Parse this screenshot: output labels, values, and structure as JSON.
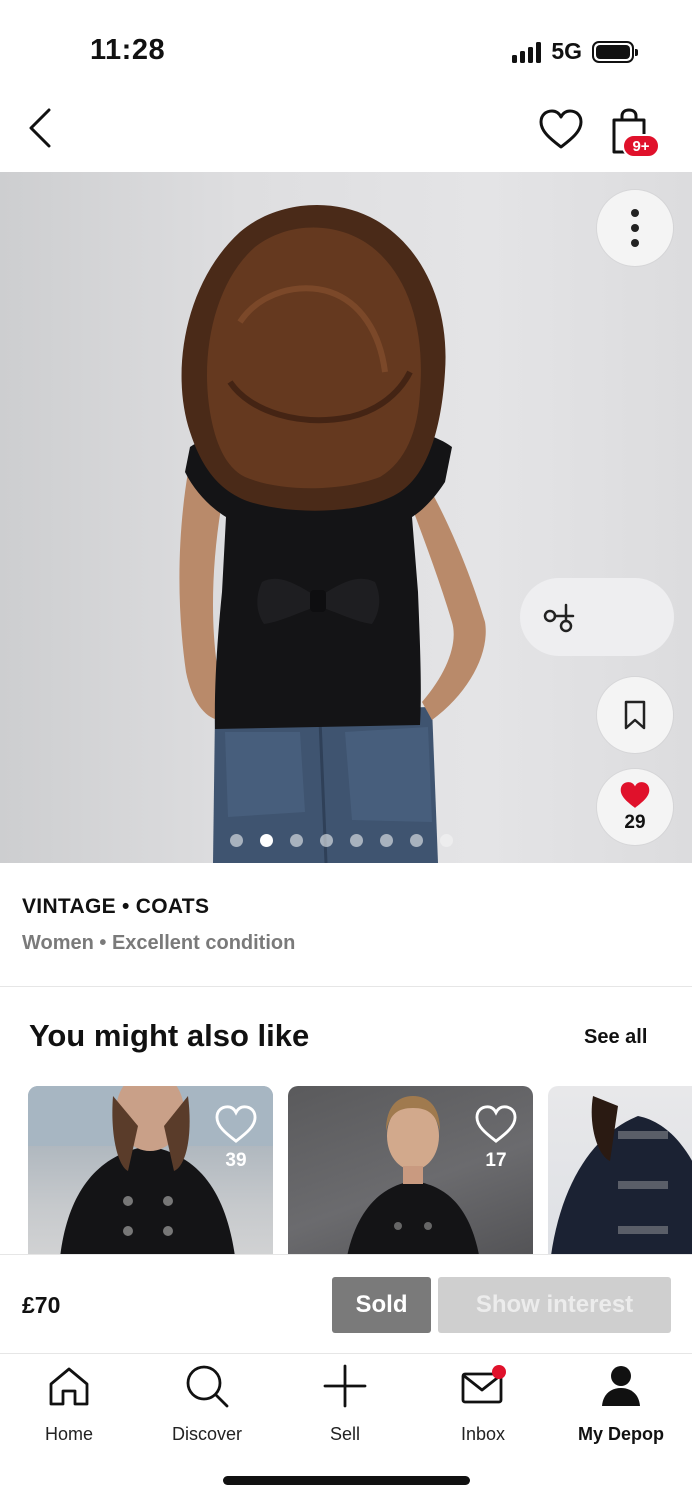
{
  "status_bar": {
    "time": "11:28",
    "network": "5G"
  },
  "header": {
    "bag_badge": "9+"
  },
  "listing": {
    "likes": "29",
    "brand_category": "VINTAGE • COATS",
    "meta": "Women • Excellent condition",
    "image_pages": {
      "total": 8,
      "current": 2
    }
  },
  "recommendations": {
    "title": "You might also like",
    "see_all": "See all",
    "items": [
      {
        "likes": "39"
      },
      {
        "likes": "17"
      },
      {
        "likes": ""
      }
    ]
  },
  "purchase": {
    "price": "£70",
    "sold_label": "Sold",
    "interest_label": "Show interest"
  },
  "tabs": [
    {
      "label": "Home",
      "icon": "home-icon"
    },
    {
      "label": "Discover",
      "icon": "search-icon"
    },
    {
      "label": "Sell",
      "icon": "plus-icon"
    },
    {
      "label": "Inbox",
      "icon": "mail-icon"
    },
    {
      "label": "My Depop",
      "icon": "person-icon"
    }
  ],
  "colors": {
    "accent_red": "#e0112b",
    "sold_gray": "#7a7a7a",
    "disabled_gray": "#cfcfcf"
  }
}
